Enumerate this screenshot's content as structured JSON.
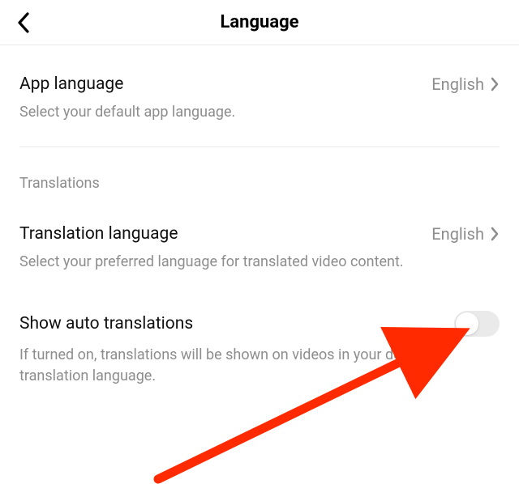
{
  "header": {
    "title": "Language"
  },
  "app_language": {
    "label": "App language",
    "value": "English",
    "description": "Select your default app language."
  },
  "translations_section": {
    "title": "Translations"
  },
  "translation_language": {
    "label": "Translation language",
    "value": "English",
    "description": "Select your preferred language for translated video content."
  },
  "show_auto": {
    "label": "Show auto translations",
    "description": "If turned on, translations will be shown on videos in your default translation language.",
    "enabled": false
  },
  "annotation": {
    "color": "#ff2a00"
  }
}
